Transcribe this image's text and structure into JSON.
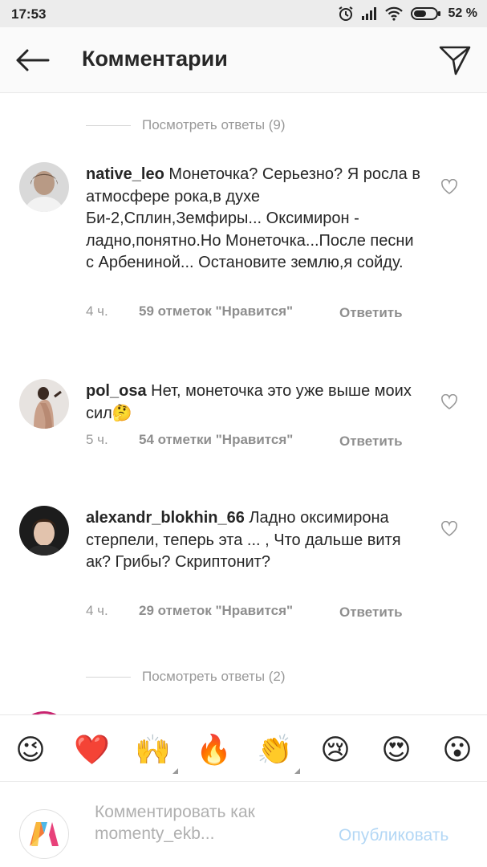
{
  "status_bar": {
    "time": "17:53",
    "battery": "52 %"
  },
  "header": {
    "title": "Комментарии"
  },
  "replies_top": "Посмотреть ответы (9)",
  "replies_bottom": "Посмотреть ответы (2)",
  "comments": [
    {
      "username": "native_leo",
      "text": " Монеточка? Серьезно? Я росла в атмосфере рока,в духе Би-2,Сплин,Земфиры... Оксимирон - ладно,понятно.Но Монеточка...После песни с Арбениной... Остановите землю,я сойду.",
      "time": "4 ч.",
      "likes": "59 отметок \"Нравится\"",
      "reply": "Ответить"
    },
    {
      "username": "pol_osa",
      "text": " Нет, монеточка это уже выше моих сил🤔",
      "time": "5 ч.",
      "likes": "54 отметки \"Нравится\"",
      "reply": "Ответить"
    },
    {
      "username": "alexandr_blokhin_66",
      "text": " Ладно оксимирона стерпели, теперь эта ... , Что дальше витя ак? Грибы? Скриптонит?",
      "time": "4 ч.",
      "likes": "29 отметок \"Нравится\"",
      "reply": "Ответить"
    }
  ],
  "emoji_bar": [
    "😉",
    "❤️",
    "🙌",
    "🔥",
    "👏",
    "😢",
    "😍",
    "😮"
  ],
  "input": {
    "placeholder": "Комментировать как momenty_ekb...",
    "publish_label": "Опубликовать"
  }
}
